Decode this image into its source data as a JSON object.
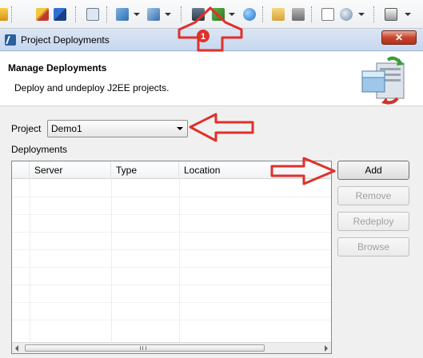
{
  "toolbar": {
    "icons": [
      "servers-icon",
      "deploy-icon",
      "project-icon",
      "wizard-icon",
      "wizard2-icon",
      "deploy-manage-icon",
      "run-icon",
      "globe-icon",
      "folder-icon",
      "tool-icon",
      "new-icon",
      "web-icon",
      "camera-icon"
    ]
  },
  "annotation": {
    "marker": "1",
    "color": "#e0302a"
  },
  "window": {
    "title": "Project Deployments",
    "close_label": "✕"
  },
  "header": {
    "title": "Manage Deployments",
    "description": "Deploy and undeploy J2EE projects."
  },
  "form": {
    "project_label": "Project",
    "project_value": "Demo1",
    "deployments_label": "Deployments"
  },
  "table": {
    "columns": [
      "Server",
      "Type",
      "Location"
    ]
  },
  "buttons": {
    "add": "Add",
    "remove": "Remove",
    "redeploy": "Redeploy",
    "browse": "Browse"
  }
}
